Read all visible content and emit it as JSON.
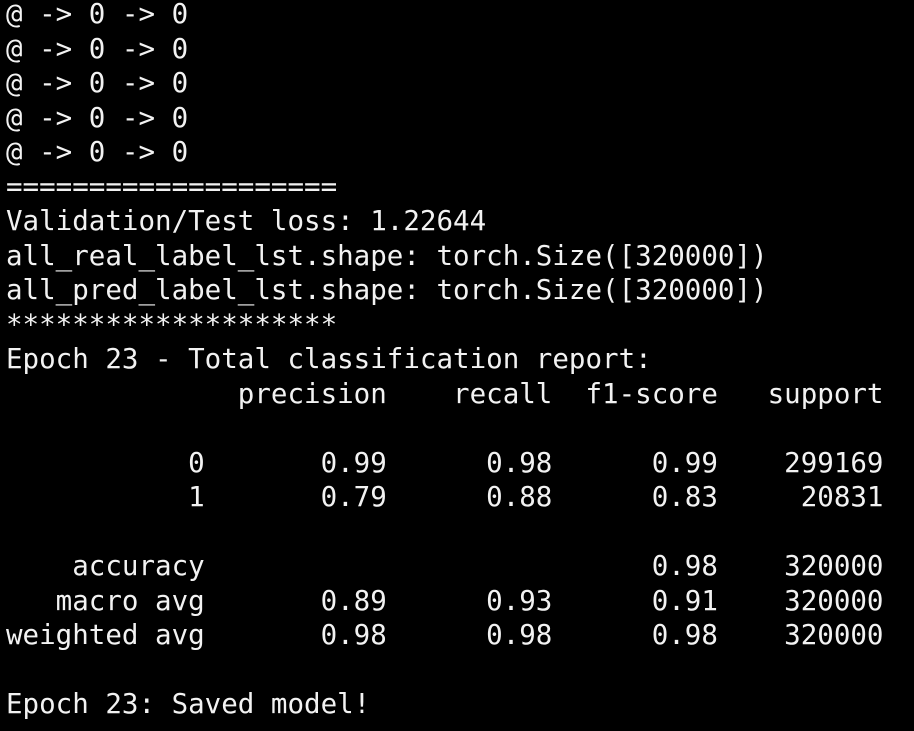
{
  "terminal": {
    "lines": [
      "@ -> 0 -> 0",
      "@ -> 0 -> 0",
      "@ -> 0 -> 0",
      "@ -> 0 -> 0",
      "@ -> 0 -> 0",
      "====================",
      "Validation/Test loss: 1.22644",
      "all_real_label_lst.shape: torch.Size([320000])",
      "all_pred_label_lst.shape: torch.Size([320000])",
      "********************",
      "Epoch 23 - Total classification report:",
      "              precision    recall  f1-score   support",
      "",
      "           0       0.99      0.98      0.99    299169",
      "           1       0.79      0.88      0.83     20831",
      "",
      "    accuracy                           0.98    320000",
      "   macro avg       0.89      0.93      0.91    320000",
      "weighted avg       0.98      0.98      0.98    320000",
      "",
      "Epoch 23: Saved model!"
    ]
  },
  "colors": {
    "background": "#000000",
    "foreground": "#f2f2f2"
  }
}
